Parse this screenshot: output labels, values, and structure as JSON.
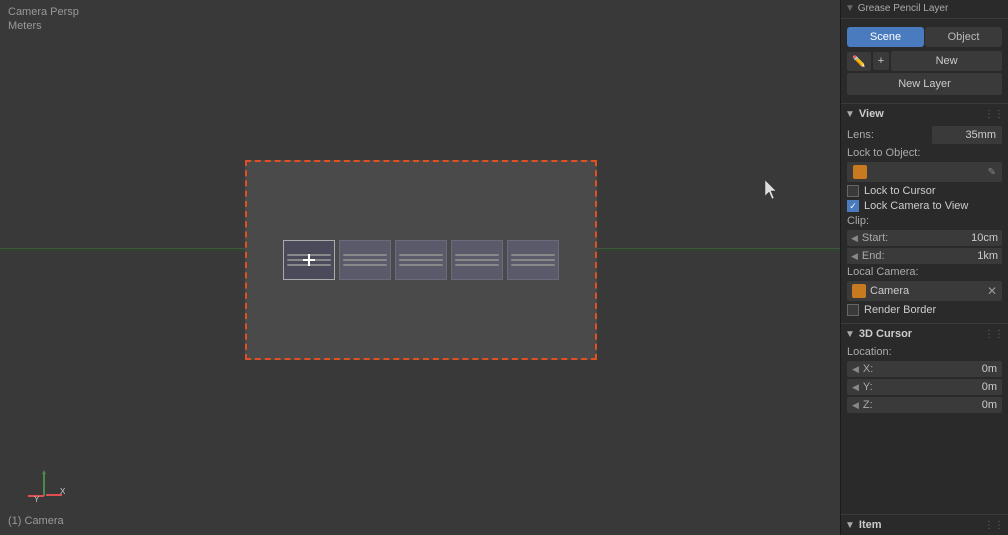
{
  "viewport": {
    "title": "Camera Persp",
    "units": "Meters",
    "bottom_status": "(1) Camera"
  },
  "panel": {
    "grease_pencil_label": "Grease Pencil Layer",
    "tabs": [
      {
        "label": "Scene",
        "active": true
      },
      {
        "label": "Object",
        "active": false
      }
    ],
    "new_button": "New",
    "new_layer_button": "New Layer",
    "view_section": {
      "title": "View",
      "lens_label": "Lens:",
      "lens_value": "35mm",
      "lock_to_object_label": "Lock to Object:",
      "lock_to_cursor_label": "Lock to Cursor",
      "lock_to_cursor_checked": false,
      "lock_camera_label": "Lock Camera to View",
      "lock_camera_checked": true,
      "clip_label": "Clip:",
      "clip_start_label": "Start:",
      "clip_start_value": "10cm",
      "clip_end_label": "End:",
      "clip_end_value": "1km",
      "local_camera_label": "Local Camera:",
      "local_camera_name": "Camera",
      "render_border_label": "Render Border",
      "render_border_checked": false
    },
    "cursor_3d_section": {
      "title": "3D Cursor",
      "location_label": "Location:",
      "x_label": "X:",
      "x_value": "0m",
      "y_label": "Y:",
      "y_value": "0m",
      "z_label": "Z:",
      "z_value": "0m"
    },
    "item_section": {
      "title": "Item"
    }
  }
}
